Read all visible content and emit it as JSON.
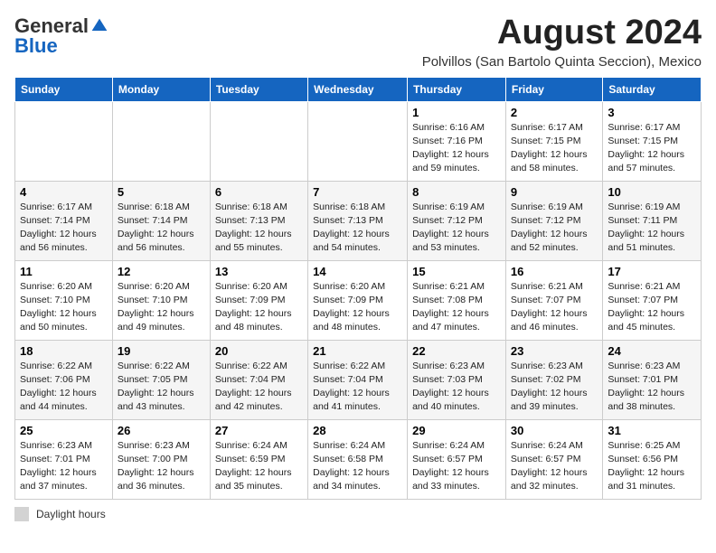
{
  "logo": {
    "general": "General",
    "blue": "Blue"
  },
  "title": "August 2024",
  "subtitle": "Polvillos (San Bartolo Quinta Seccion), Mexico",
  "days_of_week": [
    "Sunday",
    "Monday",
    "Tuesday",
    "Wednesday",
    "Thursday",
    "Friday",
    "Saturday"
  ],
  "weeks": [
    [
      {
        "day": "",
        "detail": ""
      },
      {
        "day": "",
        "detail": ""
      },
      {
        "day": "",
        "detail": ""
      },
      {
        "day": "",
        "detail": ""
      },
      {
        "day": "1",
        "detail": "Sunrise: 6:16 AM\nSunset: 7:16 PM\nDaylight: 12 hours\nand 59 minutes."
      },
      {
        "day": "2",
        "detail": "Sunrise: 6:17 AM\nSunset: 7:15 PM\nDaylight: 12 hours\nand 58 minutes."
      },
      {
        "day": "3",
        "detail": "Sunrise: 6:17 AM\nSunset: 7:15 PM\nDaylight: 12 hours\nand 57 minutes."
      }
    ],
    [
      {
        "day": "4",
        "detail": "Sunrise: 6:17 AM\nSunset: 7:14 PM\nDaylight: 12 hours\nand 56 minutes."
      },
      {
        "day": "5",
        "detail": "Sunrise: 6:18 AM\nSunset: 7:14 PM\nDaylight: 12 hours\nand 56 minutes."
      },
      {
        "day": "6",
        "detail": "Sunrise: 6:18 AM\nSunset: 7:13 PM\nDaylight: 12 hours\nand 55 minutes."
      },
      {
        "day": "7",
        "detail": "Sunrise: 6:18 AM\nSunset: 7:13 PM\nDaylight: 12 hours\nand 54 minutes."
      },
      {
        "day": "8",
        "detail": "Sunrise: 6:19 AM\nSunset: 7:12 PM\nDaylight: 12 hours\nand 53 minutes."
      },
      {
        "day": "9",
        "detail": "Sunrise: 6:19 AM\nSunset: 7:12 PM\nDaylight: 12 hours\nand 52 minutes."
      },
      {
        "day": "10",
        "detail": "Sunrise: 6:19 AM\nSunset: 7:11 PM\nDaylight: 12 hours\nand 51 minutes."
      }
    ],
    [
      {
        "day": "11",
        "detail": "Sunrise: 6:20 AM\nSunset: 7:10 PM\nDaylight: 12 hours\nand 50 minutes."
      },
      {
        "day": "12",
        "detail": "Sunrise: 6:20 AM\nSunset: 7:10 PM\nDaylight: 12 hours\nand 49 minutes."
      },
      {
        "day": "13",
        "detail": "Sunrise: 6:20 AM\nSunset: 7:09 PM\nDaylight: 12 hours\nand 48 minutes."
      },
      {
        "day": "14",
        "detail": "Sunrise: 6:20 AM\nSunset: 7:09 PM\nDaylight: 12 hours\nand 48 minutes."
      },
      {
        "day": "15",
        "detail": "Sunrise: 6:21 AM\nSunset: 7:08 PM\nDaylight: 12 hours\nand 47 minutes."
      },
      {
        "day": "16",
        "detail": "Sunrise: 6:21 AM\nSunset: 7:07 PM\nDaylight: 12 hours\nand 46 minutes."
      },
      {
        "day": "17",
        "detail": "Sunrise: 6:21 AM\nSunset: 7:07 PM\nDaylight: 12 hours\nand 45 minutes."
      }
    ],
    [
      {
        "day": "18",
        "detail": "Sunrise: 6:22 AM\nSunset: 7:06 PM\nDaylight: 12 hours\nand 44 minutes."
      },
      {
        "day": "19",
        "detail": "Sunrise: 6:22 AM\nSunset: 7:05 PM\nDaylight: 12 hours\nand 43 minutes."
      },
      {
        "day": "20",
        "detail": "Sunrise: 6:22 AM\nSunset: 7:04 PM\nDaylight: 12 hours\nand 42 minutes."
      },
      {
        "day": "21",
        "detail": "Sunrise: 6:22 AM\nSunset: 7:04 PM\nDaylight: 12 hours\nand 41 minutes."
      },
      {
        "day": "22",
        "detail": "Sunrise: 6:23 AM\nSunset: 7:03 PM\nDaylight: 12 hours\nand 40 minutes."
      },
      {
        "day": "23",
        "detail": "Sunrise: 6:23 AM\nSunset: 7:02 PM\nDaylight: 12 hours\nand 39 minutes."
      },
      {
        "day": "24",
        "detail": "Sunrise: 6:23 AM\nSunset: 7:01 PM\nDaylight: 12 hours\nand 38 minutes."
      }
    ],
    [
      {
        "day": "25",
        "detail": "Sunrise: 6:23 AM\nSunset: 7:01 PM\nDaylight: 12 hours\nand 37 minutes."
      },
      {
        "day": "26",
        "detail": "Sunrise: 6:23 AM\nSunset: 7:00 PM\nDaylight: 12 hours\nand 36 minutes."
      },
      {
        "day": "27",
        "detail": "Sunrise: 6:24 AM\nSunset: 6:59 PM\nDaylight: 12 hours\nand 35 minutes."
      },
      {
        "day": "28",
        "detail": "Sunrise: 6:24 AM\nSunset: 6:58 PM\nDaylight: 12 hours\nand 34 minutes."
      },
      {
        "day": "29",
        "detail": "Sunrise: 6:24 AM\nSunset: 6:57 PM\nDaylight: 12 hours\nand 33 minutes."
      },
      {
        "day": "30",
        "detail": "Sunrise: 6:24 AM\nSunset: 6:57 PM\nDaylight: 12 hours\nand 32 minutes."
      },
      {
        "day": "31",
        "detail": "Sunrise: 6:25 AM\nSunset: 6:56 PM\nDaylight: 12 hours\nand 31 minutes."
      }
    ]
  ],
  "footer": {
    "label": "Daylight hours"
  }
}
